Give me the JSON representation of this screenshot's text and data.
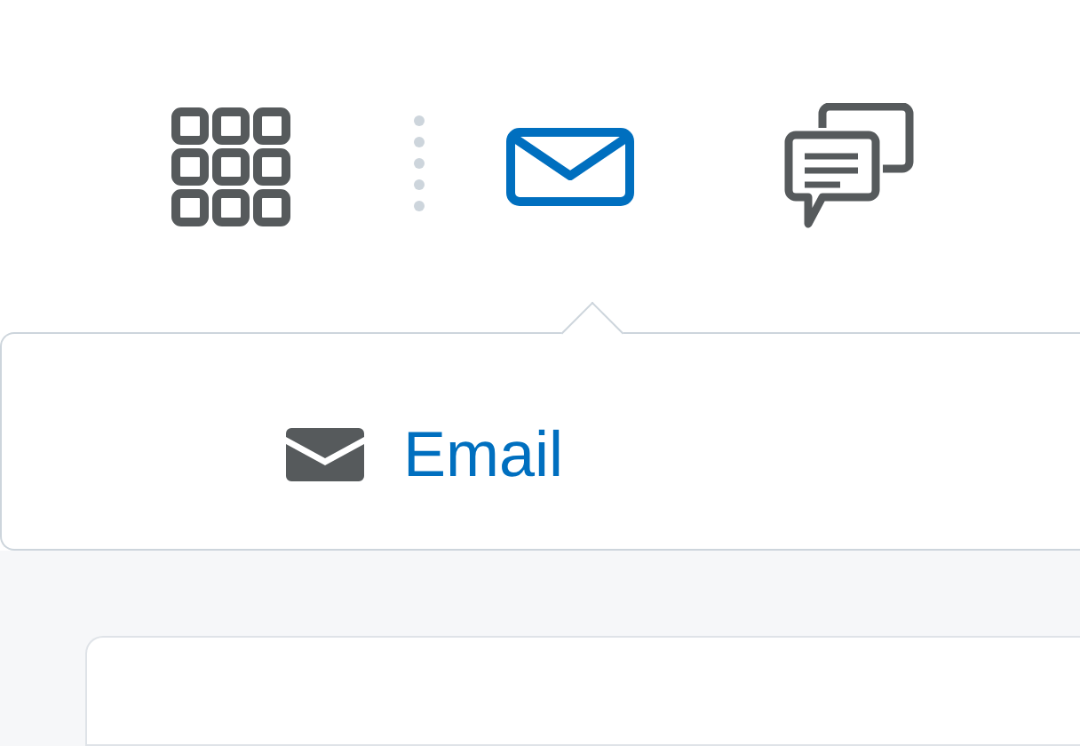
{
  "toolbar": {
    "items": [
      {
        "kind": "grid",
        "selected": false
      },
      {
        "kind": "separator"
      },
      {
        "kind": "mail",
        "selected": true
      },
      {
        "kind": "chat",
        "selected": false
      }
    ]
  },
  "dropdown": {
    "items": [
      {
        "kind": "mail",
        "label": "Email"
      }
    ]
  }
}
